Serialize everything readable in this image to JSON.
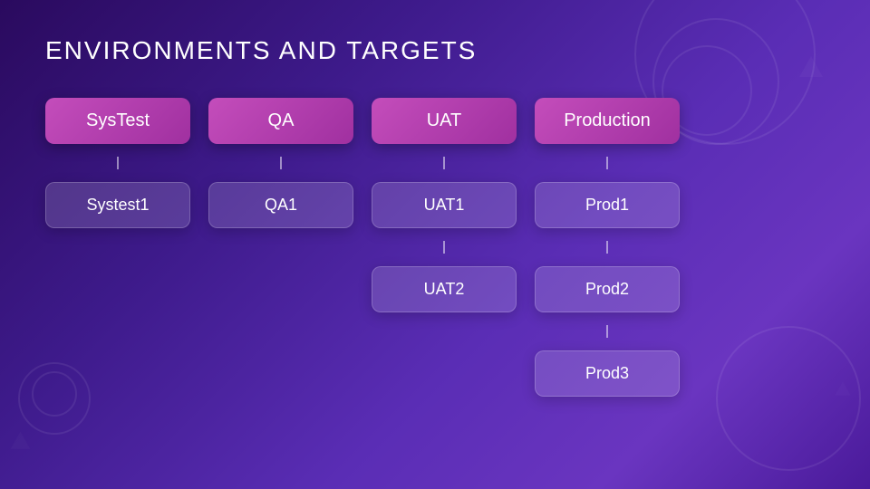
{
  "page": {
    "title": "ENVIRONMENTS AND TARGETS",
    "columns": [
      {
        "id": "systest",
        "header": "SysTest",
        "targets": [
          "Systest1"
        ]
      },
      {
        "id": "qa",
        "header": "QA",
        "targets": [
          "QA1"
        ]
      },
      {
        "id": "uat",
        "header": "UAT",
        "targets": [
          "UAT1",
          "UAT2"
        ]
      },
      {
        "id": "production",
        "header": "Production",
        "targets": [
          "Prod1",
          "Prod2",
          "Prod3"
        ]
      }
    ]
  }
}
